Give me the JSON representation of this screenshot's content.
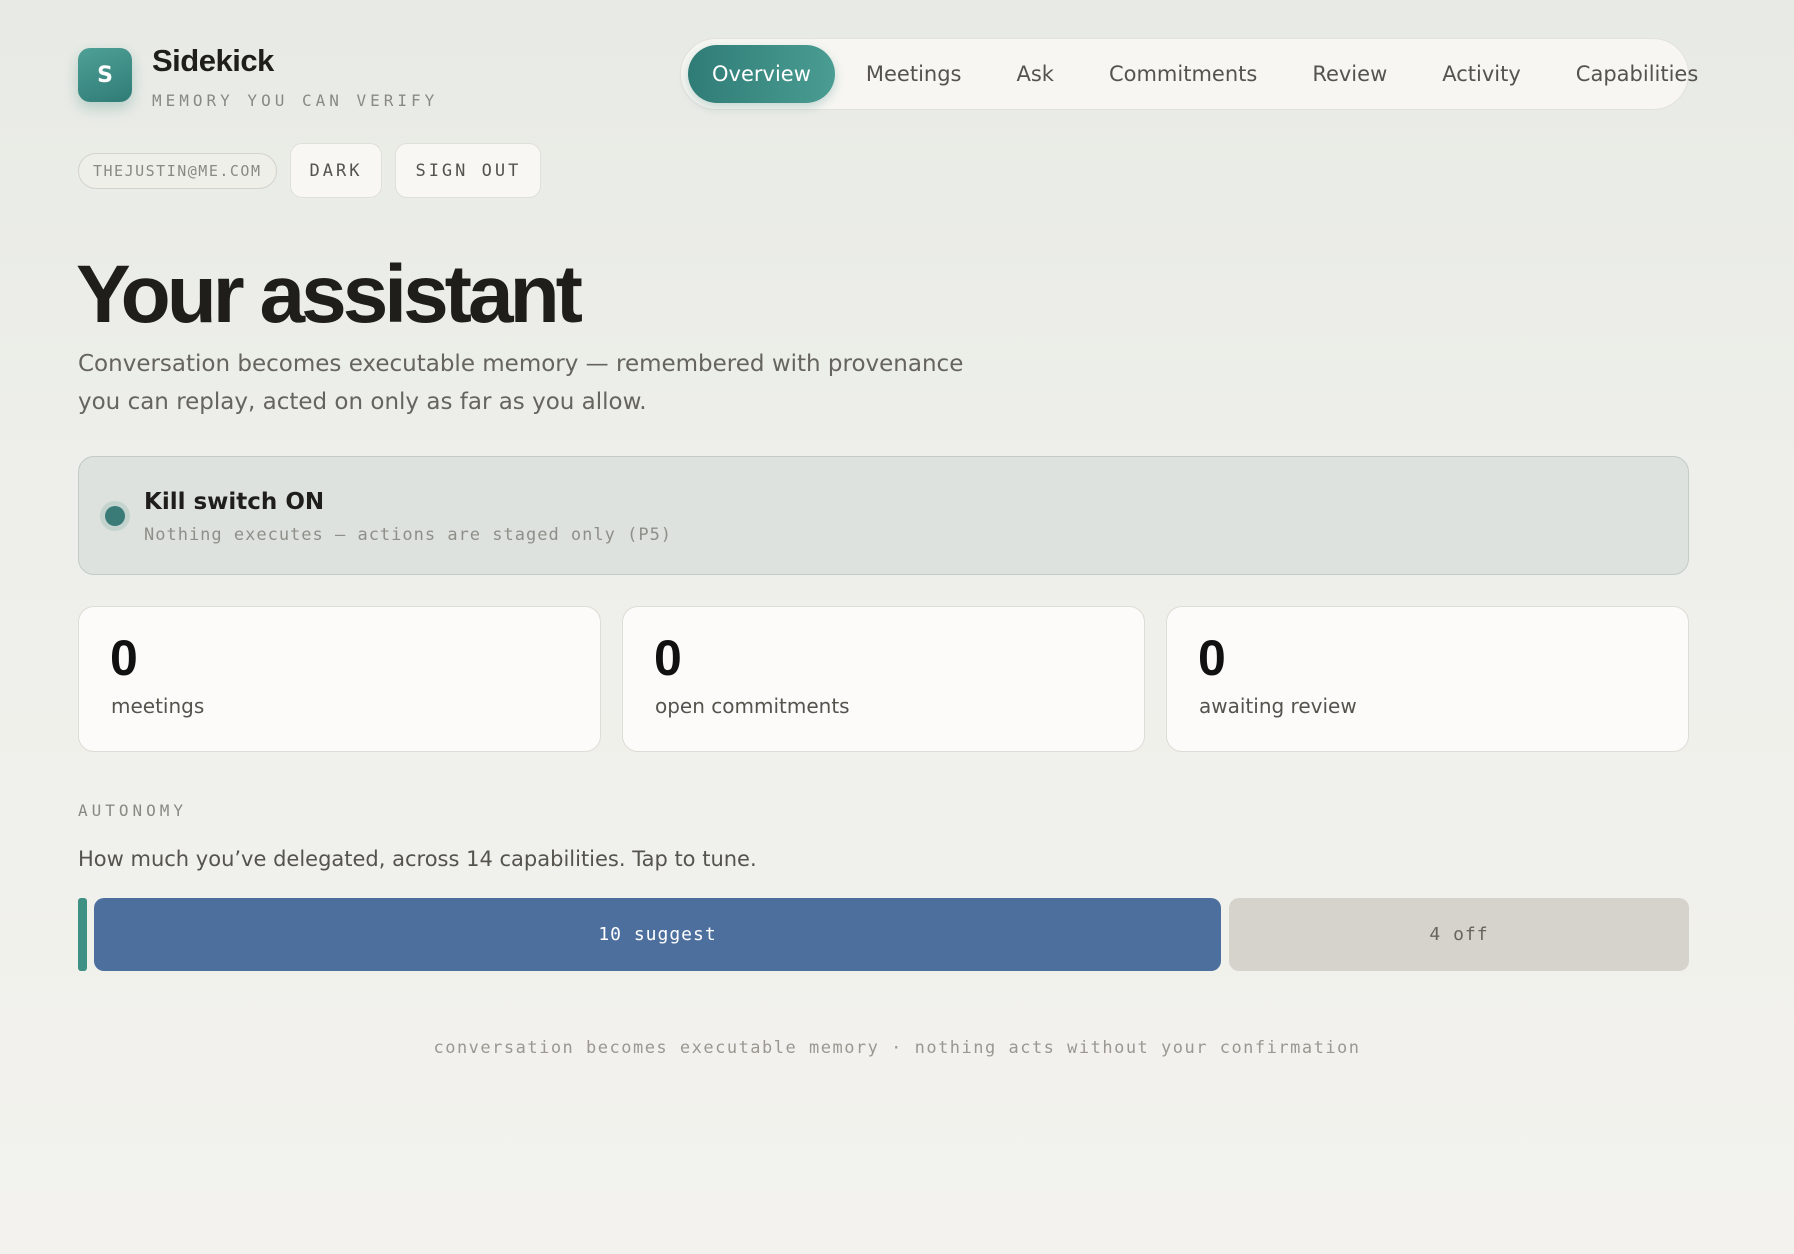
{
  "brand": {
    "logo_letter": "S",
    "name": "Sidekick",
    "tagline": "MEMORY YOU CAN VERIFY",
    "accent_color": "#2f7c76"
  },
  "nav": {
    "tabs": [
      {
        "label": "Overview",
        "active": true
      },
      {
        "label": "Meetings",
        "active": false
      },
      {
        "label": "Ask",
        "active": false
      },
      {
        "label": "Commitments",
        "active": false
      },
      {
        "label": "Review",
        "active": false
      },
      {
        "label": "Activity",
        "active": false
      },
      {
        "label": "Capabilities",
        "active": false
      }
    ]
  },
  "account": {
    "email": "THEJUSTIN@ME.COM",
    "theme_label": "DARK",
    "signout_label": "SIGN OUT"
  },
  "header": {
    "title": "Your assistant",
    "subtitle": "Conversation becomes executable memory — remembered with provenance you can replay, acted on only as far as you allow."
  },
  "kill_switch": {
    "title": "Kill switch ON",
    "subtitle": "Nothing executes — actions are staged only (P5)",
    "status_color": "#3a7b78"
  },
  "stats": [
    {
      "value": "0",
      "label": "meetings"
    },
    {
      "value": "0",
      "label": "open commitments"
    },
    {
      "value": "0",
      "label": "awaiting review"
    }
  ],
  "autonomy": {
    "section_label": "AUTONOMY",
    "description": "How much you’ve delegated, across 14 capabilities. Tap to tune.",
    "segments": [
      {
        "label": "10 suggest",
        "count": 10,
        "color": "#4d6f9e"
      },
      {
        "label": "4 off",
        "count": 4,
        "color": "#d6d3cc"
      }
    ]
  },
  "footer": {
    "text": "conversation becomes executable memory · nothing acts without your confirmation"
  }
}
